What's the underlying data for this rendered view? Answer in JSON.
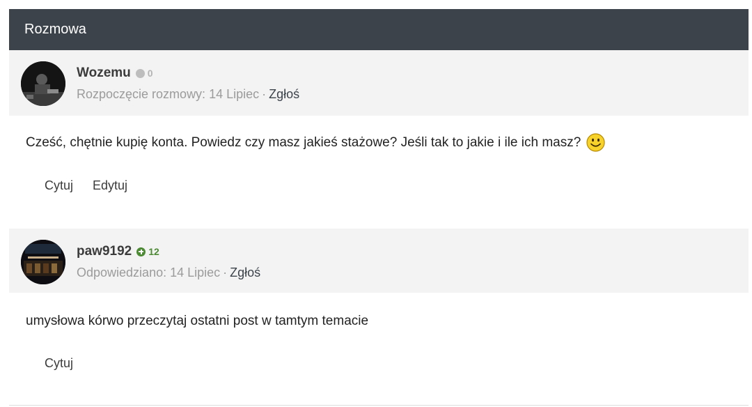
{
  "header": {
    "title": "Rozmowa"
  },
  "posts": [
    {
      "author": "Wozemu",
      "reputation": "0",
      "reputation_type": "neutral",
      "meta_label": "Rozpoczęcie rozmowy: 14 Lipiec",
      "separator": "·",
      "report": "Zgłoś",
      "body": "Cześć, chętnie kupię konta. Powiedz czy masz jakieś stażowe? Jeśli tak to jakie i ile ich masz?",
      "emoji": "smiley-icon",
      "actions": [
        "Cytuj",
        "Edytuj"
      ]
    },
    {
      "author": "paw9192",
      "reputation": "12",
      "reputation_type": "positive",
      "meta_label": "Odpowiedziano: 14 Lipiec",
      "separator": "·",
      "report": "Zgłoś",
      "body": "umysłowa kórwo przeczytaj ostatni post w tamtym temacie",
      "actions": [
        "Cytuj"
      ]
    }
  ],
  "colors": {
    "header_bg": "#3c434b",
    "post_head_bg": "#f3f3f3",
    "reputation_positive": "#4d8a34",
    "reputation_neutral": "#bdbdbd"
  }
}
